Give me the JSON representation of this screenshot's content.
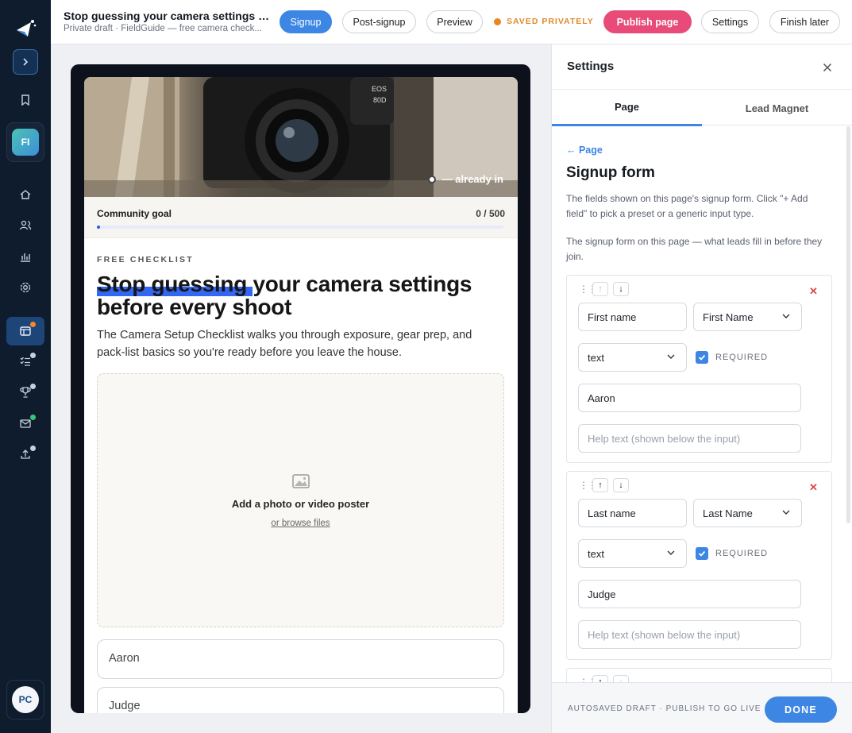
{
  "header": {
    "title": "Stop guessing your camera settings b...",
    "subtitle": "Private draft · FieldGuide — free camera check...",
    "tabs": [
      {
        "label": "Signup"
      },
      {
        "label": "Post-signup"
      },
      {
        "label": "Preview"
      }
    ],
    "saved_label": "SAVED PRIVATELY",
    "publish_label": "Publish page",
    "settings_label": "Settings",
    "finish_label": "Finish later"
  },
  "rail": {
    "workspace_initials": "FI",
    "user_initials": "PC",
    "icons": [
      "bookmark-icon",
      "home-icon",
      "users-icon",
      "chart-icon",
      "gear-icon",
      "pages-icon",
      "checklist-icon",
      "trophy-icon",
      "mail-icon",
      "upload-icon"
    ]
  },
  "preview": {
    "hero_badge": "— already in",
    "goal_label": "Community goal",
    "goal_value": "0 / 500",
    "goal_progress": 0.0,
    "eyebrow": "FREE CHECKLIST",
    "headline_lead": "Stop guessing",
    "headline_rest": " your camera settings before every shoot",
    "description": "The Camera Setup Checklist walks you through exposure, gear prep, and pack-list basics so you're ready before you leave the house.",
    "drop_title": "Add a photo or video poster",
    "drop_browse": "or browse files",
    "field_first": "Aaron",
    "field_last": "Judge"
  },
  "settings": {
    "title": "Settings",
    "tabs": [
      {
        "label": "Page"
      },
      {
        "label": "Lead Magnet"
      }
    ],
    "back_label": "← Page",
    "section_title": "Signup form",
    "help_1": "The fields shown on this page's signup form. Click \"+ Add field\" to pick a preset or a generic input type.",
    "help_2": "The signup form on this page — what leads fill in before they join.",
    "fields": [
      {
        "label": "First name",
        "preset": "First Name",
        "type": "text",
        "required_label": "REQUIRED",
        "default": "Aaron",
        "help_placeholder": "Help text (shown below the input)"
      },
      {
        "label": "Last name",
        "preset": "Last Name",
        "type": "text",
        "required_label": "REQUIRED",
        "default": "Judge",
        "help_placeholder": "Help text (shown below the input)"
      }
    ],
    "footer_note": "AUTOSAVED DRAFT · PUBLISH TO GO LIVE",
    "done_label": "DONE"
  },
  "colors": {
    "accent": "#3d86e4",
    "publish": "#e84b78",
    "saved": "#e08a2a",
    "rail": "#0f1c2e"
  }
}
